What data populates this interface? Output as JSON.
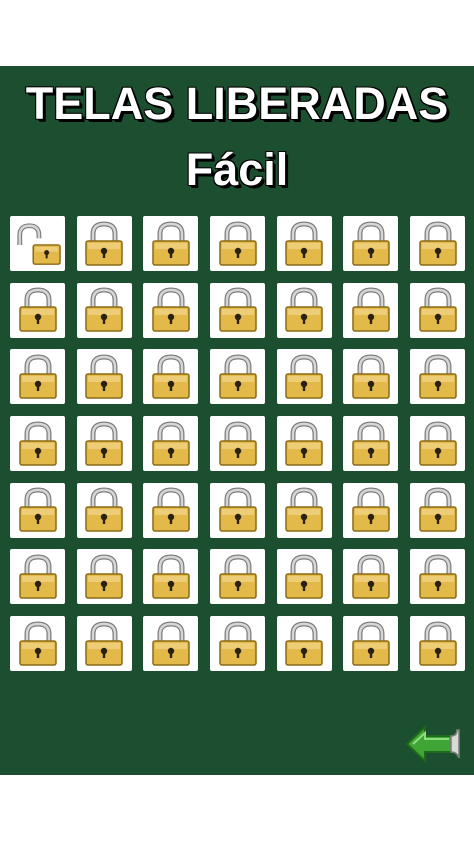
{
  "header": {
    "title": "TELAS LIBERADAS",
    "level": "Fácil"
  },
  "levels": {
    "total": 49,
    "columns": 7,
    "unlocked_count": 1,
    "unlocked_icon": "open-padlock-icon",
    "locked_icon": "padlock-icon"
  },
  "footer": {
    "back_icon": "back-arrow-icon"
  },
  "colors": {
    "board": "#1c4f2f",
    "tile": "#ffffff",
    "lock_body": "#e3b94a",
    "arrow": "#3fa535"
  }
}
